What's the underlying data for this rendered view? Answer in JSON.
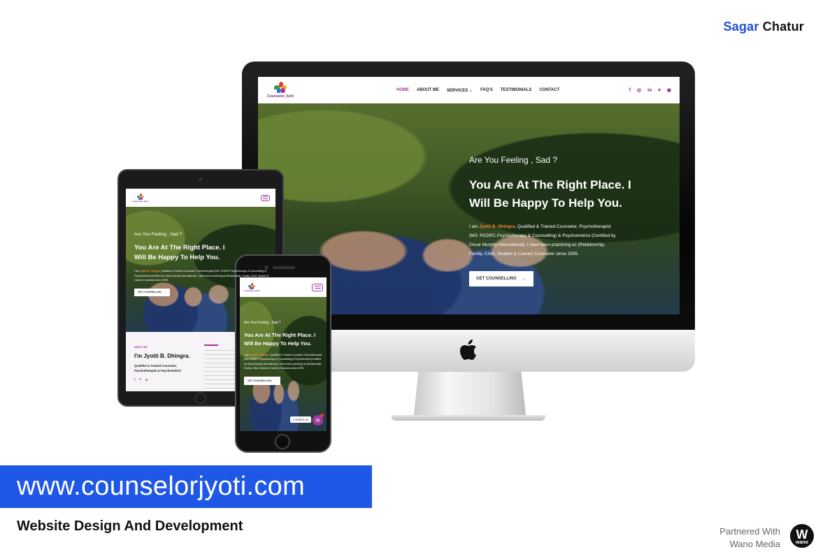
{
  "brand": {
    "first": "Sagar",
    "last": "Chatur"
  },
  "footer": {
    "url": "www.counselorjyoti.com",
    "subtitle": "Website Design And Development",
    "partner_line1": "Partnered With",
    "partner_line2": "Wano Media",
    "partner_logo_letter": "W",
    "partner_logo_text": "wano"
  },
  "site": {
    "logo_name": "Counselor Jyoti",
    "nav": [
      "HOME",
      "ABOUT ME",
      "SERVICES",
      "FAQ'S",
      "TESTIMONIALS",
      "CONTACT"
    ],
    "socials": [
      "f",
      "◎",
      "in",
      "▾",
      "◉"
    ],
    "hero_kicker": "Are You Feeling , Sad  ?",
    "hero_title_1": "You Are At The Right Place. I",
    "hero_title_2": "Will Be Happy To Help You.",
    "hero_desc_pre": "I am ",
    "hero_desc_name": "Jyotti B. Dhingra",
    "hero_desc_1": ", Qualified & Trained Counselor, Psychotherapist",
    "hero_desc_2": "(MS: PGDPC Psychotherapy & Counselling) & Psychometrist (Certified by",
    "hero_desc_3": "Oscar Murphy International). I have been practicing as (Relationship,",
    "hero_desc_4": "Family, Child, Student & Career) Counselor since 2005.",
    "cta": "GET COUNSELLING",
    "about_label": "ABOUT ME",
    "about_title": "I'm Jyotti B. Dhingra.",
    "about_sub_1": "Qualified & Trained Counselor,",
    "about_sub_2": "Psychotherapist & Psychometrist",
    "contact_label": "Contact us"
  },
  "colors": {
    "brand_blue": "#1f57e7",
    "accent_purple": "#a32f9d",
    "highlight_orange": "#f08a3a"
  }
}
